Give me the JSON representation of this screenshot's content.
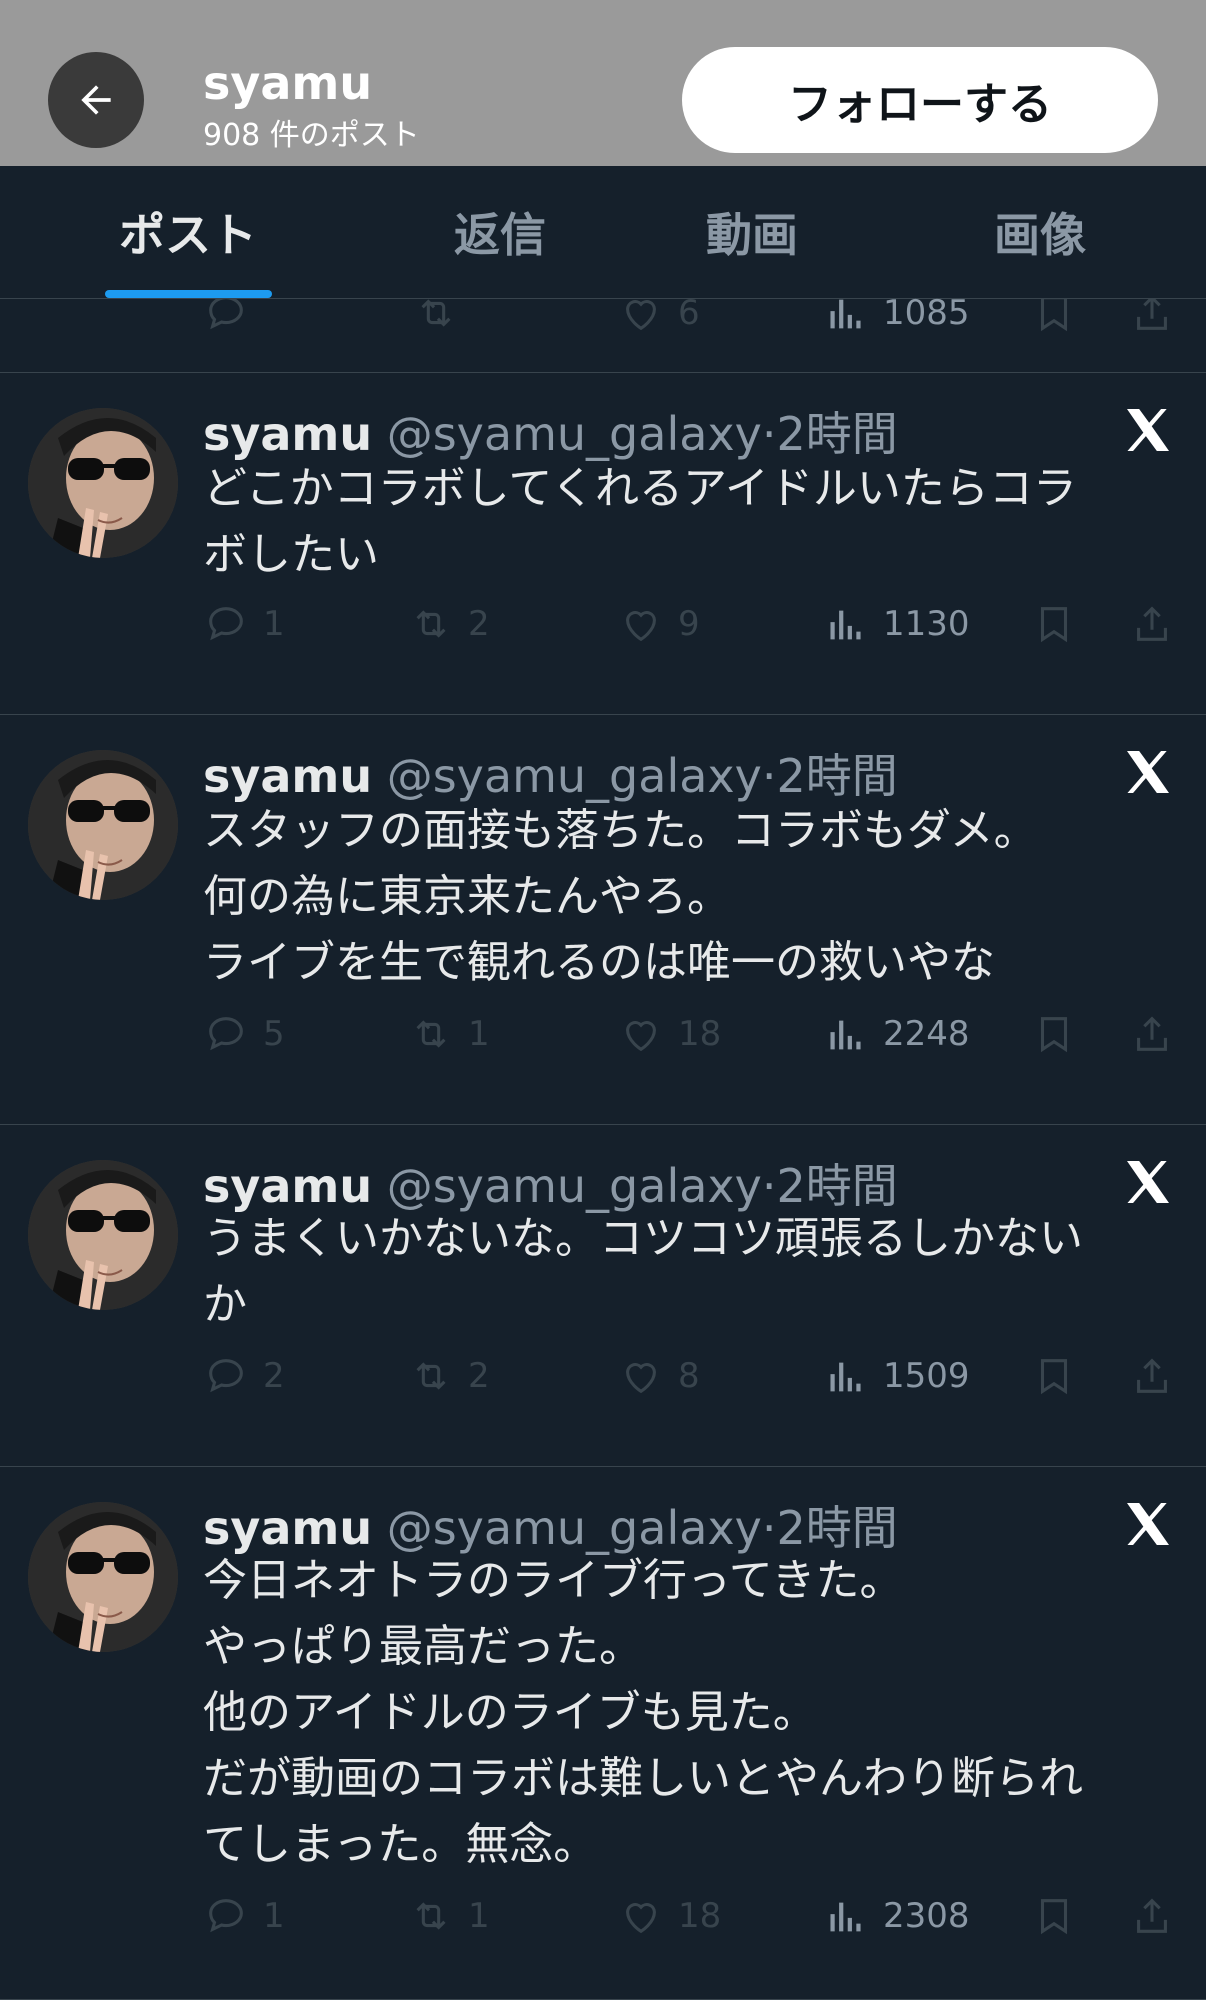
{
  "header": {
    "name": "syamu",
    "post_count": "908 件のポスト",
    "follow_label": "フォローする"
  },
  "tabs": [
    {
      "label": "ポスト",
      "active": true
    },
    {
      "label": "返信",
      "active": false
    },
    {
      "label": "動画",
      "active": false
    },
    {
      "label": "画像",
      "active": false
    }
  ],
  "partial_post": {
    "likes": "6",
    "views": "1085"
  },
  "posts": [
    {
      "name": "syamu",
      "handle": "@syamu_galaxy",
      "time": "·2時間",
      "text": "どこかコラボしてくれるアイドルいたらコラ\nボしたい",
      "replies": "1",
      "reposts": "2",
      "likes": "9",
      "views": "1130"
    },
    {
      "name": "syamu",
      "handle": "@syamu_galaxy",
      "time": "·2時間",
      "text": "スタッフの面接も落ちた。コラボもダメ。\n何の為に東京来たんやろ。\nライブを生で観れるのは唯一の救いやな",
      "replies": "5",
      "reposts": "1",
      "likes": "18",
      "views": "2248"
    },
    {
      "name": "syamu",
      "handle": "@syamu_galaxy",
      "time": "·2時間",
      "text": "うまくいかないな。コツコツ頑張るしかない\nか",
      "replies": "2",
      "reposts": "2",
      "likes": "8",
      "views": "1509"
    },
    {
      "name": "syamu",
      "handle": "@syamu_galaxy",
      "time": "·2時間",
      "text": "今日ネオトラのライブ行ってきた。\nやっぱり最高だった。\n他のアイドルのライブも見た。\nだが動画のコラボは難しいとやんわり断られ\nてしまった。無念。",
      "replies": "1",
      "reposts": "1",
      "likes": "18",
      "views": "2308"
    }
  ],
  "icons": {
    "back": "arrow-left-icon",
    "x_logo": "x-logo-icon",
    "reply": "reply-icon",
    "repost": "repost-icon",
    "like": "heart-icon",
    "views": "views-icon",
    "bookmark": "bookmark-icon",
    "share": "share-icon"
  },
  "colors": {
    "background": "#15202b",
    "accent": "#1d9bf0",
    "header_bg": "#9a9a9a"
  }
}
